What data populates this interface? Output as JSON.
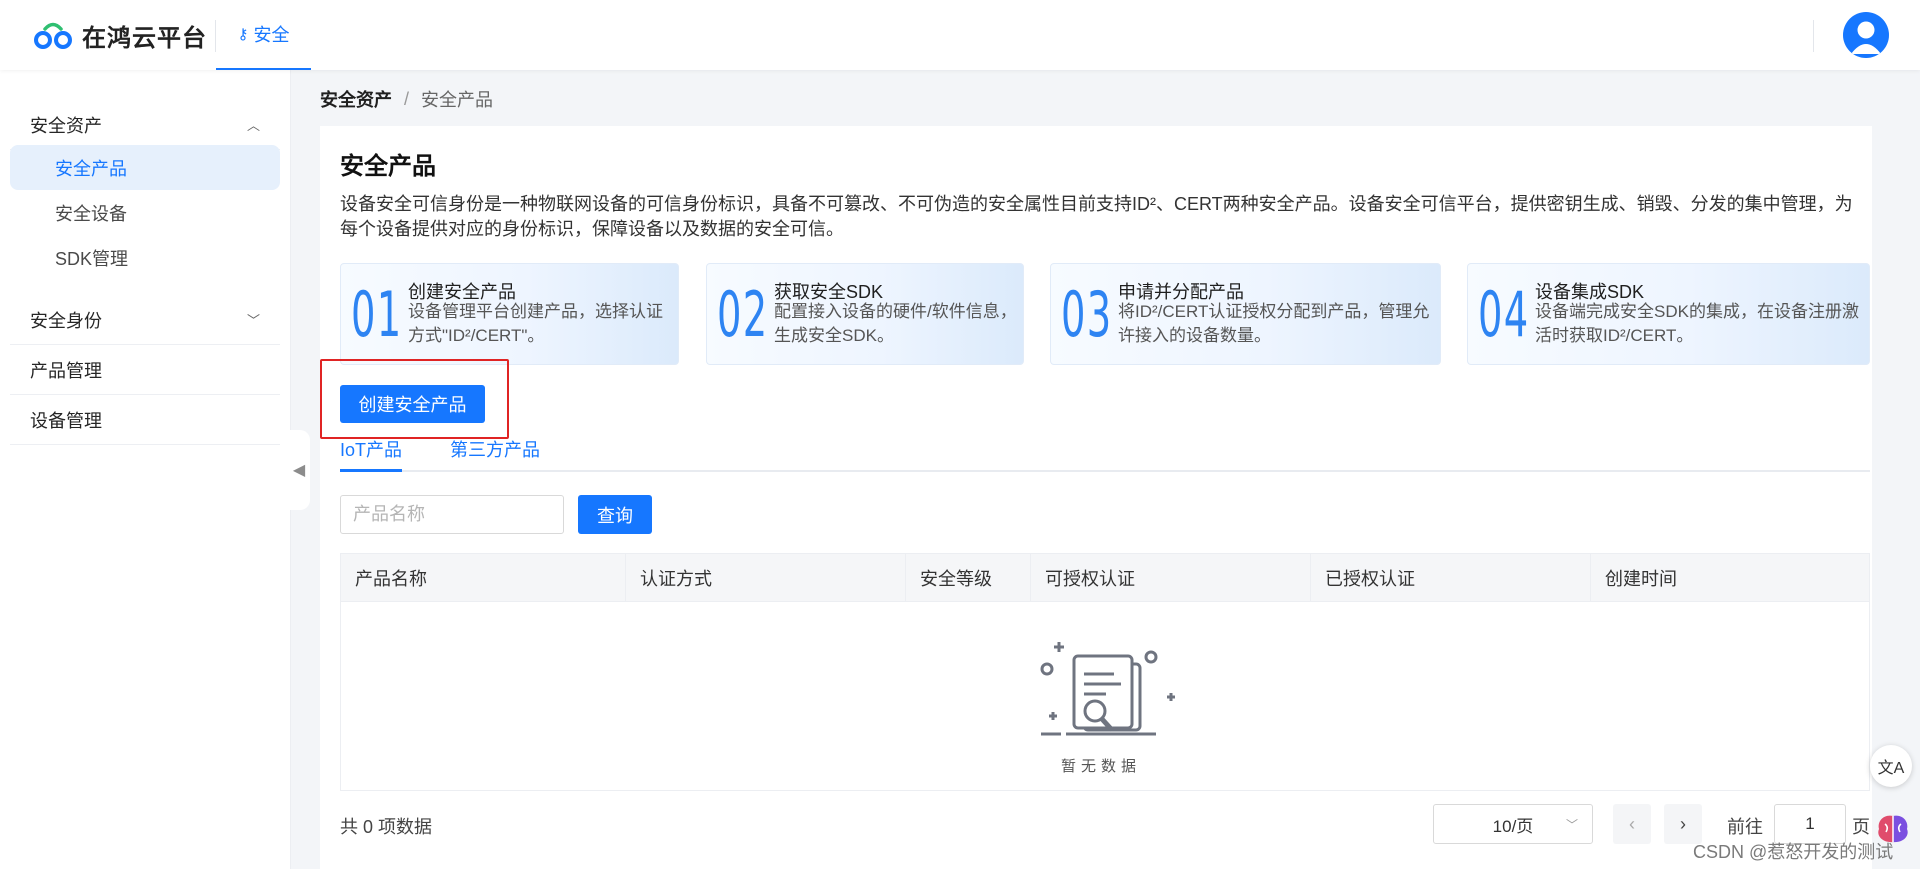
{
  "header": {
    "logo_text": "在鸿云平台",
    "nav_label": "安全",
    "nav_icon": "key-icon"
  },
  "sidebar": {
    "groups": [
      {
        "label": "安全资产",
        "expanded": true,
        "items": [
          {
            "label": "安全产品",
            "active": true
          },
          {
            "label": "安全设备"
          },
          {
            "label": "SDK管理"
          }
        ]
      },
      {
        "label": "安全身份",
        "expanded": false
      },
      {
        "label": "产品管理"
      },
      {
        "label": "设备管理"
      }
    ]
  },
  "breadcrumb": {
    "root": "安全资产",
    "separator": "/",
    "current": "安全产品"
  },
  "page": {
    "title": "安全产品",
    "description": "设备安全可信身份是一种物联网设备的可信身份标识，具备不可篡改、不可伪造的安全属性目前支持ID²、CERT两种安全产品。设备安全可信平台，提供密钥生成、销毁、分发的集中管理，为每个设备提供对应的身份标识，保障设备以及数据的安全可信。"
  },
  "steps": [
    {
      "num": "01",
      "title": "创建安全产品",
      "desc": "设备管理平台创建产品，选择认证方式\"ID²/CERT\"。"
    },
    {
      "num": "02",
      "title": "获取安全SDK",
      "desc": "配置接入设备的硬件/软件信息，生成安全SDK。"
    },
    {
      "num": "03",
      "title": "申请并分配产品",
      "desc": "将ID²/CERT认证授权分配到产品，管理允许接入的设备数量。"
    },
    {
      "num": "04",
      "title": "设备集成SDK",
      "desc": "设备端完成安全SDK的集成，在设备注册激活时获取ID²/CERT。"
    }
  ],
  "actions": {
    "create_label": "创建安全产品"
  },
  "tabs": [
    {
      "label": "IoT产品",
      "active": true
    },
    {
      "label": "第三方产品"
    }
  ],
  "search": {
    "placeholder": "产品名称",
    "value": "",
    "query_label": "查询"
  },
  "table": {
    "columns": [
      "产品名称",
      "认证方式",
      "安全等级",
      "可授权认证",
      "已授权认证",
      "创建时间"
    ],
    "rows": [],
    "empty_text": "暂无数据"
  },
  "pagination": {
    "total_text": "共 0 项数据",
    "page_size": "10/页",
    "prev_icon": "chevron-left-icon",
    "next_icon": "chevron-right-icon",
    "goto_label": "前往",
    "goto_value": "1",
    "goto_suffix": "页"
  },
  "watermark": "CSDN @惹怒开发的测试",
  "colors": {
    "primary": "#1677ff",
    "highlight": "#e02424",
    "step_number": "#2e84f2"
  }
}
